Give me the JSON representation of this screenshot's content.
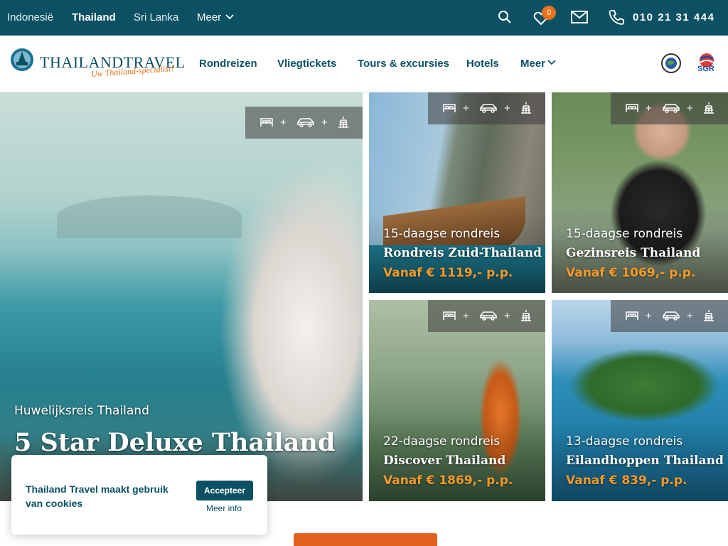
{
  "topbar": {
    "countries": [
      "Indonesië",
      "Thailand",
      "Sri Lanka"
    ],
    "active_country": "Thailand",
    "more_label": "Meer",
    "favorites_count": "0",
    "phone": "010 21 31 444"
  },
  "header": {
    "logo_word": "THAILANDTRAVEL",
    "logo_tagline": "Uw Thailand-specialist!",
    "nav": [
      "Rondreizen",
      "Vliegtickets",
      "Tours & excursies",
      "Hotels",
      "Meer"
    ],
    "badges": [
      "sgr-logo",
      "calamiteitenfonds-logo"
    ],
    "badge_text": "SGR"
  },
  "tiles": [
    {
      "subtitle": "Huwelijksreis Thailand",
      "title": "5 Star Deluxe Thailand",
      "price": ""
    },
    {
      "subtitle": "15-daagse rondreis",
      "title": "Rondreis Zuid-Thailand",
      "price": "Vanaf € 1119,- p.p."
    },
    {
      "subtitle": "15-daagse rondreis",
      "title": "Gezinsreis Thailand",
      "price": "Vanaf € 1069,- p.p."
    },
    {
      "subtitle": "22-daagse rondreis",
      "title": "Discover Thailand",
      "price": "Vanaf € 1869,- p.p."
    },
    {
      "subtitle": "13-daagse rondreis",
      "title": "Eilandhoppen Thailand",
      "price": "Vanaf € 839,- p.p."
    }
  ],
  "tile_icons": [
    "bed-icon",
    "car-icon",
    "temple-icon"
  ],
  "plus_sign": "+",
  "cookie": {
    "text": "Thailand Travel maakt gebruik van cookies",
    "accept_label": "Accepteer",
    "more_label": "Meer info"
  },
  "colors": {
    "primary": "#0b5163",
    "accent": "#e8711b",
    "price": "#f39a2b"
  }
}
